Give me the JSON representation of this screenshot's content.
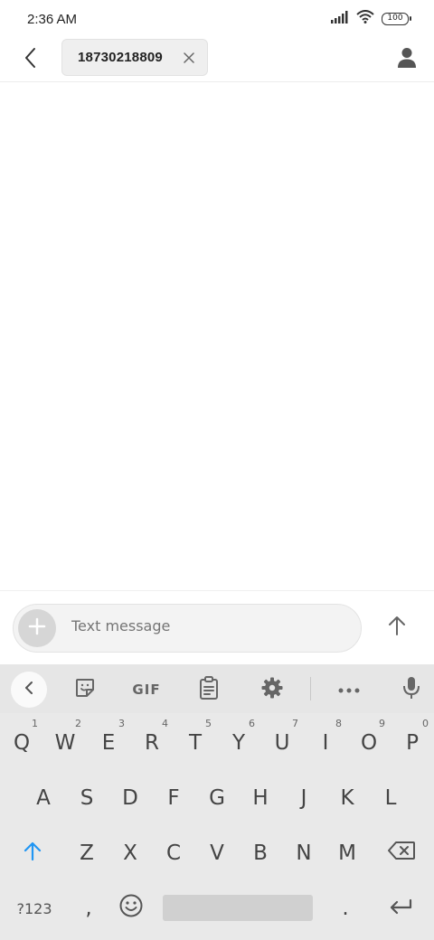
{
  "status_bar": {
    "time": "2:36 AM",
    "battery": "100",
    "signal_icon": "signal-icon",
    "wifi_icon": "wifi-icon"
  },
  "header": {
    "back_icon": "back-arrow-icon",
    "recipient": "18730218809",
    "remove_icon": "close-icon",
    "contact_icon": "person-icon"
  },
  "compose": {
    "placeholder": "Text message",
    "attach_icon": "plus-icon",
    "send_icon": "up-arrow-icon"
  },
  "keyboard": {
    "toolbar": {
      "collapse_icon": "chevron-left-icon",
      "sticker_icon": "sticker-icon",
      "gif_label": "GIF",
      "clipboard_icon": "clipboard-icon",
      "settings_icon": "gear-icon",
      "more_icon": "more-icon",
      "mic_icon": "microphone-icon"
    },
    "row1": [
      {
        "key": "Q",
        "hint": "1"
      },
      {
        "key": "W",
        "hint": "2"
      },
      {
        "key": "E",
        "hint": "3"
      },
      {
        "key": "R",
        "hint": "4"
      },
      {
        "key": "T",
        "hint": "5"
      },
      {
        "key": "Y",
        "hint": "6"
      },
      {
        "key": "U",
        "hint": "7"
      },
      {
        "key": "I",
        "hint": "8"
      },
      {
        "key": "O",
        "hint": "9"
      },
      {
        "key": "P",
        "hint": "0"
      }
    ],
    "row2": [
      "A",
      "S",
      "D",
      "F",
      "G",
      "H",
      "J",
      "K",
      "L"
    ],
    "row3": [
      "Z",
      "X",
      "C",
      "V",
      "B",
      "N",
      "M"
    ],
    "row4": {
      "symbols": "?123",
      "comma": ",",
      "period": ".",
      "emoji_icon": "emoji-icon",
      "enter_icon": "enter-icon"
    },
    "shift_icon": "shift-icon",
    "backspace_icon": "backspace-icon",
    "accent_color": "#2196f3"
  }
}
